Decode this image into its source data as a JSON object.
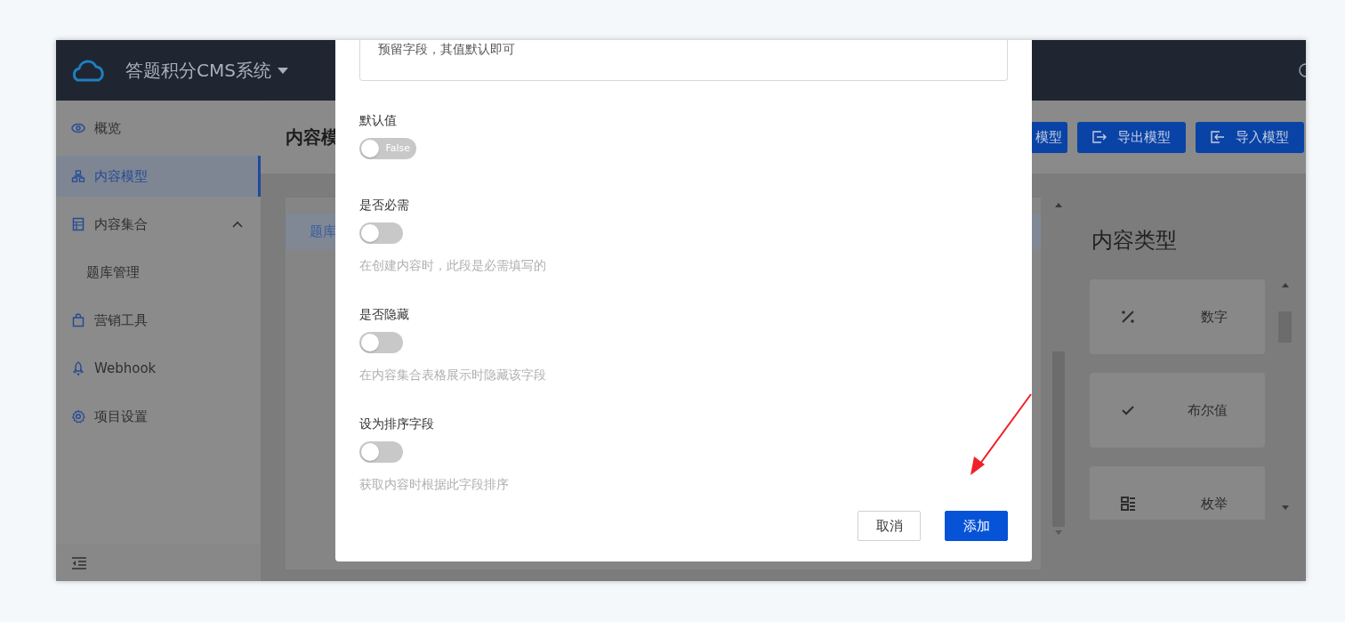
{
  "app": {
    "title": "答题积分CMS系统"
  },
  "sidebar": {
    "items": [
      {
        "label": "概览",
        "selected": false
      },
      {
        "label": "内容模型",
        "selected": true
      },
      {
        "label": "内容集合",
        "selected": false,
        "expanded": true,
        "children": [
          {
            "label": "题库管理",
            "selected": false
          }
        ]
      },
      {
        "label": "营销工具",
        "selected": false
      },
      {
        "label": "Webhook",
        "selected": false
      },
      {
        "label": "项目设置",
        "selected": false
      }
    ]
  },
  "page": {
    "title": "内容模",
    "buttons": [
      "模型",
      "导出模型",
      "导入模型"
    ]
  },
  "collection_tabs": [
    {
      "label": "题库",
      "selected": true
    }
  ],
  "content_types": {
    "title": "内容类型",
    "items": [
      {
        "label": "数字"
      },
      {
        "label": "布尔值"
      },
      {
        "label": "枚举"
      }
    ]
  },
  "dialog": {
    "description_value": "预留字段，其值默认即可",
    "fields": [
      {
        "label": "默认值",
        "on": false,
        "toggle_text": "False"
      },
      {
        "label": "是否必需",
        "on": false,
        "hint": "在创建内容时，此段是必需填写的"
      },
      {
        "label": "是否隐藏",
        "on": false,
        "hint": "在内容集合表格展示时隐藏该字段"
      },
      {
        "label": "设为排序字段",
        "on": false,
        "hint": "获取内容时根据此字段排序"
      }
    ],
    "buttons": [
      {
        "label": "取消",
        "kind": "secondary"
      },
      {
        "label": "添加",
        "kind": "primary"
      }
    ]
  }
}
